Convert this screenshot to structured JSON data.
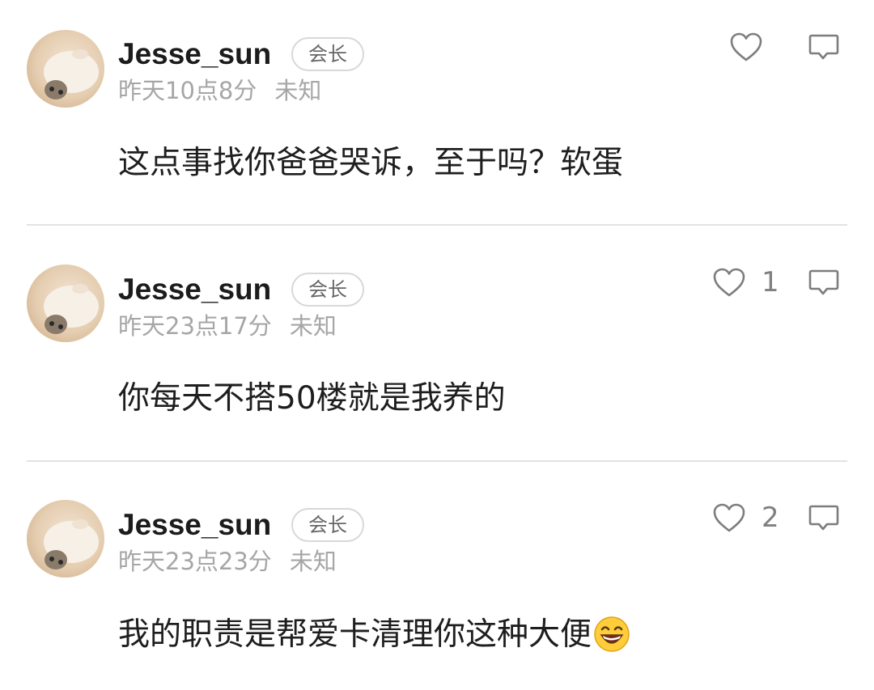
{
  "comments": [
    {
      "username": "Jesse_sun",
      "badge": "会长",
      "time": "昨天10点8分",
      "location": "未知",
      "text": "这点事找你爸爸哭诉，至于吗？软蛋",
      "likes": "",
      "has_emoji": false
    },
    {
      "username": "Jesse_sun",
      "badge": "会长",
      "time": "昨天23点17分",
      "location": "未知",
      "text": "你每天不搭50楼就是我养的",
      "likes": "1",
      "has_emoji": false
    },
    {
      "username": "Jesse_sun",
      "badge": "会长",
      "time": "昨天23点23分",
      "location": "未知",
      "text": "我的职责是帮爱卡清理你这种大便",
      "likes": "2",
      "has_emoji": true,
      "emoji": "grinning-face-emoji"
    }
  ],
  "icons": {
    "like": "heart-outline-icon",
    "reply": "speech-bubble-icon"
  },
  "colors": {
    "text": "#1e1e1e",
    "meta": "#a6a6a6",
    "icon": "#7d7d7d",
    "divider": "#e3e3e3"
  }
}
